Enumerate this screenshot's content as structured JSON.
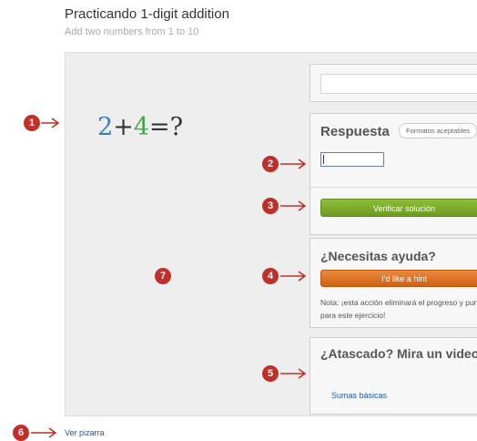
{
  "page": {
    "title": "Practicando 1-digit addition",
    "subtitle": "Add two numbers from 1 to 10"
  },
  "problem": {
    "num1": "2",
    "op": "+",
    "num2": "4",
    "eq": "=?"
  },
  "answer_panel": {
    "heading": "Respuesta",
    "formats_label": "Formatos aceptables",
    "input_value": "",
    "check_button": "Verificar solución"
  },
  "help_panel": {
    "heading": "¿Necesitas ayuda?",
    "hint_button": "I'd like a hint",
    "note": "Nota: ¡esta acción eliminará el progreso y puntos para este ejercicio!"
  },
  "stuck_panel": {
    "heading": "¿Atascado? Mira un video.",
    "video_link": "Sumas básicas"
  },
  "footer": {
    "scratchpad_link": "Ver pizarra"
  },
  "callouts": [
    "1",
    "2",
    "3",
    "4",
    "5",
    "6",
    "7"
  ],
  "colors": {
    "callout": "#c0302a",
    "check_button": "#7aa82a",
    "hint_button": "#de7325",
    "link": "#1f5bb0",
    "num1": "#3a7ec6",
    "num2": "#44a84a"
  }
}
